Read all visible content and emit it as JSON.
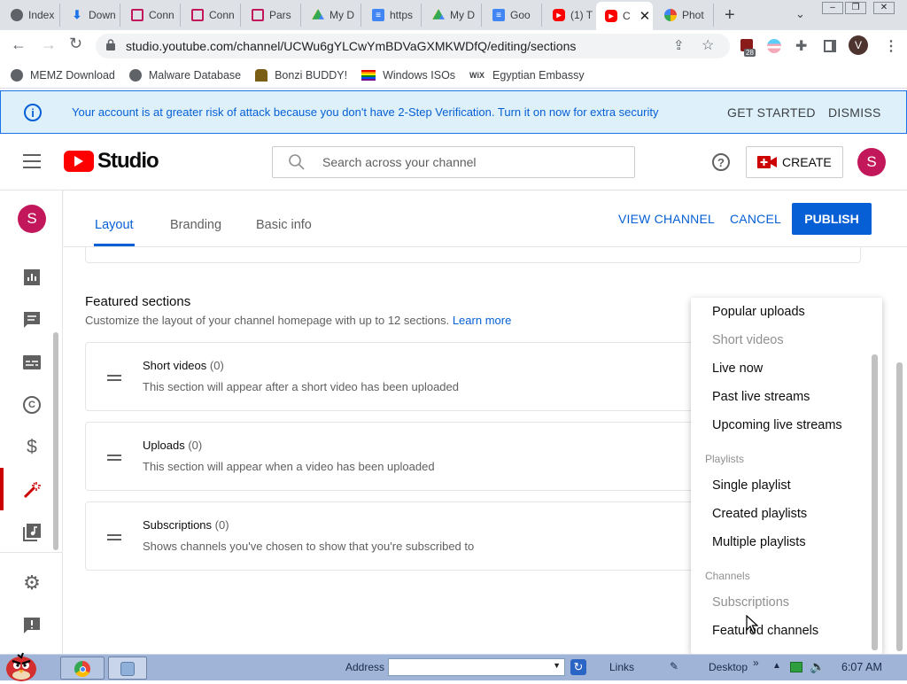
{
  "browser": {
    "tabs": [
      {
        "label": "Index",
        "icon": "globe-icon",
        "color": "#5f6368"
      },
      {
        "label": "Down",
        "icon": "download-icon",
        "color": "#1a73e8"
      },
      {
        "label": "Conn",
        "icon": "document-icon",
        "color": "#c2185b"
      },
      {
        "label": "Conn",
        "icon": "document-icon",
        "color": "#c2185b"
      },
      {
        "label": "Pars",
        "icon": "document-icon",
        "color": "#c2185b"
      },
      {
        "label": "My D",
        "icon": "drive-icon",
        "color": "#34a853"
      },
      {
        "label": "https",
        "icon": "docs-icon",
        "color": "#4285f4"
      },
      {
        "label": "My D",
        "icon": "drive-icon",
        "color": "#34a853"
      },
      {
        "label": "Goo",
        "icon": "docs-icon",
        "color": "#4285f4"
      },
      {
        "label": "(1) T",
        "icon": "youtube-icon",
        "color": "#ff0000"
      },
      {
        "label": "C",
        "icon": "youtube-icon",
        "color": "#ff0000",
        "active": true
      },
      {
        "label": "Phot",
        "icon": "photos-icon",
        "color": "#fbbc04"
      }
    ],
    "url": "studio.youtube.com/channel/UCWu6gYLCwYmBDVaGXMKWDfQ/editing/sections",
    "extension_badge": "28",
    "profile_initial": "V",
    "bookmarks": [
      {
        "label": "MEMZ Download",
        "icon": "globe-icon"
      },
      {
        "label": "Malware Database",
        "icon": "globe-icon"
      },
      {
        "label": "Bonzi BUDDY!",
        "icon": "bonzi-icon"
      },
      {
        "label": "Windows ISOs",
        "icon": "rainbow-flag-icon"
      },
      {
        "label": "Egyptian Embassy",
        "icon": "wix-icon"
      }
    ]
  },
  "banner": {
    "message": "Your account is at greater risk of attack because you don't have 2-Step Verification. Turn it on now for extra security",
    "get_started": "GET STARTED",
    "dismiss": "DISMISS"
  },
  "studio": {
    "logo_text": "Studio",
    "search_placeholder": "Search across your channel",
    "create_label": "CREATE",
    "avatar_initial": "S"
  },
  "customization": {
    "tabs": [
      "Layout",
      "Branding",
      "Basic info"
    ],
    "view_channel": "VIEW CHANNEL",
    "cancel": "CANCEL",
    "publish": "PUBLISH"
  },
  "featured": {
    "heading": "Featured sections",
    "description": "Customize the layout of your channel homepage with up to 12 sections.",
    "learn_more": "Learn more",
    "sections": [
      {
        "title": "Short videos",
        "count": "(0)",
        "desc": "This section will appear after a short video has been uploaded"
      },
      {
        "title": "Uploads",
        "count": "(0)",
        "desc": "This section will appear when a video has been uploaded"
      },
      {
        "title": "Subscriptions",
        "count": "(0)",
        "desc": "Shows channels you've chosen to show that you're subscribed to"
      }
    ]
  },
  "dropdown": {
    "items": [
      {
        "label": "Popular uploads"
      },
      {
        "label": "Short videos",
        "disabled": true
      },
      {
        "label": "Live now"
      },
      {
        "label": "Past live streams"
      },
      {
        "label": "Upcoming live streams"
      },
      {
        "heading": "Playlists"
      },
      {
        "label": "Single playlist"
      },
      {
        "label": "Created playlists"
      },
      {
        "label": "Multiple playlists"
      },
      {
        "heading": "Channels"
      },
      {
        "label": "Subscriptions",
        "disabled": true
      },
      {
        "label": "Featured channels"
      }
    ]
  },
  "taskbar": {
    "address_label": "Address",
    "links_label": "Links",
    "desktop_label": "Desktop",
    "time": "6:07 AM"
  },
  "colors": {
    "brand_blue": "#065fd4",
    "youtube_red": "#ff0000",
    "banner_bg": "#def1fb",
    "active_nav": "#cc0000"
  }
}
